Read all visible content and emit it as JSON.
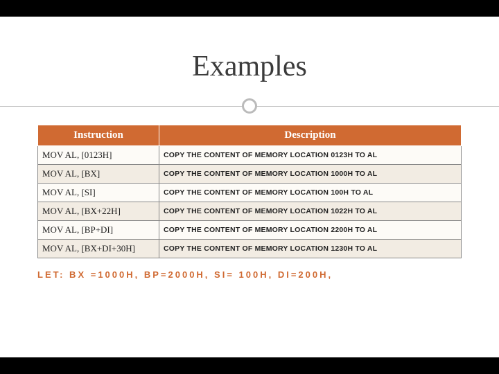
{
  "title": "Examples",
  "headers": {
    "instruction": "Instruction",
    "description": "Description"
  },
  "rows": [
    {
      "instr": "MOV AL, [0123H]",
      "desc": "COPY THE CONTENT OF MEMORY LOCATION 0123H TO AL"
    },
    {
      "instr": "MOV AL, [BX]",
      "desc": "COPY THE CONTENT OF MEMORY LOCATION 1000H TO AL"
    },
    {
      "instr": "MOV AL, [SI]",
      "desc": "COPY THE CONTENT OF MEMORY LOCATION 100H TO AL"
    },
    {
      "instr": "MOV AL, [BX+22H]",
      "desc": "COPY THE CONTENT OF MEMORY LOCATION 1022H TO AL"
    },
    {
      "instr": "MOV AL, [BP+DI]",
      "desc": "COPY THE CONTENT OF MEMORY LOCATION 2200H TO AL"
    },
    {
      "instr": "MOV AL, [BX+DI+30H]",
      "desc": "COPY THE CONTENT OF MEMORY LOCATION 1230H TO AL"
    }
  ],
  "footer": "LET: BX =1000H, BP=2000H, SI= 100H, DI=200H,"
}
